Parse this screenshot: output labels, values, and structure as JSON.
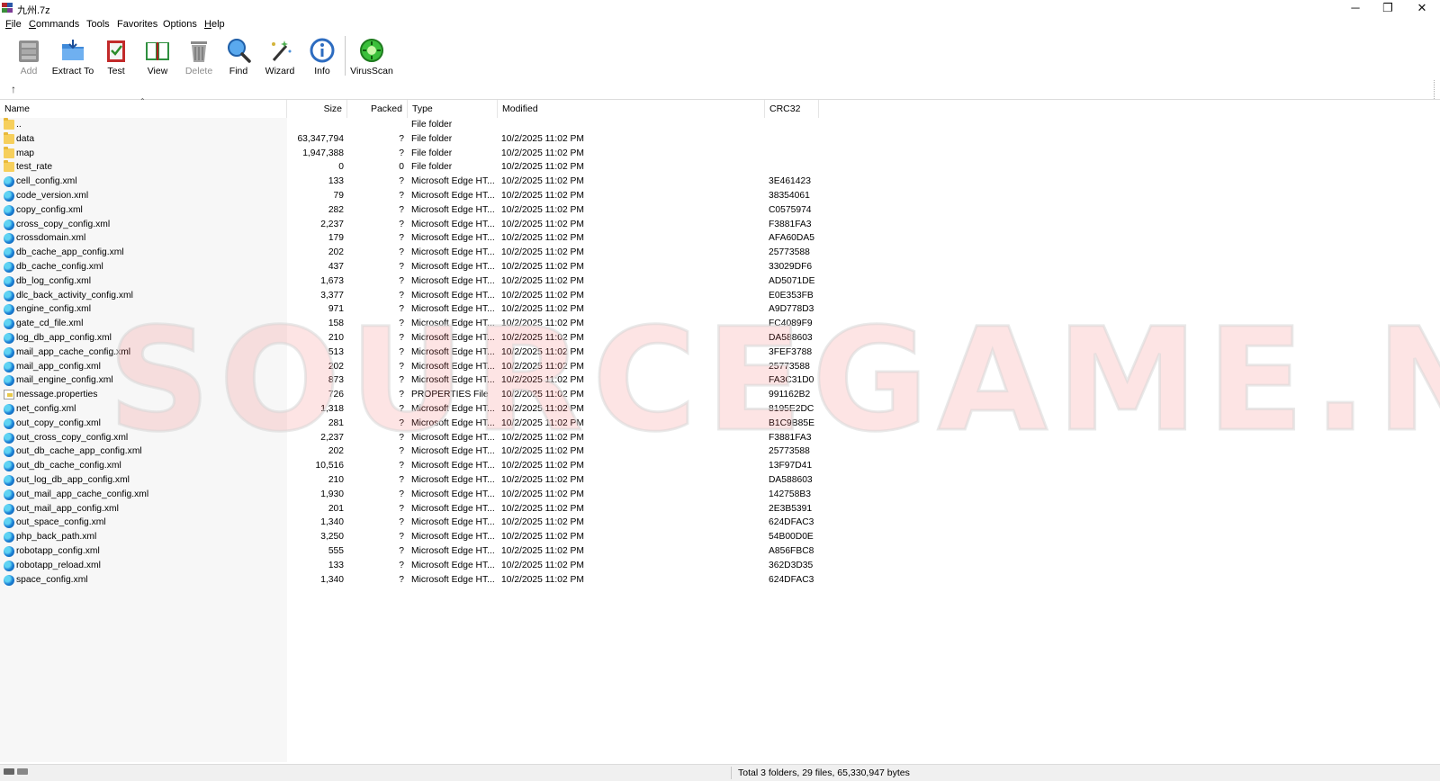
{
  "window": {
    "title": "九州.7z",
    "controls": [
      "─",
      "❐",
      "✕"
    ]
  },
  "menu": [
    {
      "label": "File",
      "key": "F",
      "rest": "ile"
    },
    {
      "label": "Commands",
      "key": "C",
      "rest": "ommands"
    },
    {
      "label": "Tools",
      "key": "",
      "rest": "Tools"
    },
    {
      "label": "Favorites",
      "key": "",
      "rest": "Favorites"
    },
    {
      "label": "Options",
      "key": "",
      "rest": "Options"
    },
    {
      "label": "Help",
      "key": "H",
      "rest": "elp"
    }
  ],
  "toolbar": {
    "add": "Add",
    "extract": "Extract To",
    "test": "Test",
    "view": "View",
    "delete": "Delete",
    "find": "Find",
    "wizard": "Wizard",
    "info": "Info",
    "virusscan": "VirusScan"
  },
  "columns": {
    "name": "Name",
    "size": "Size",
    "packed": "Packed",
    "type": "Type",
    "modified": "Modified",
    "crc": "CRC32"
  },
  "files": [
    {
      "name": "..",
      "size": "",
      "packed": "",
      "type": "File folder",
      "modified": "",
      "crc": "",
      "icon": "folder-icon"
    },
    {
      "name": "data",
      "size": "63,347,794",
      "packed": "?",
      "type": "File folder",
      "modified": "10/2/2025 11:02 PM",
      "crc": "",
      "icon": "folder-icon"
    },
    {
      "name": "map",
      "size": "1,947,388",
      "packed": "?",
      "type": "File folder",
      "modified": "10/2/2025 11:02 PM",
      "crc": "",
      "icon": "folder-icon"
    },
    {
      "name": "test_rate",
      "size": "0",
      "packed": "0",
      "type": "File folder",
      "modified": "10/2/2025 11:02 PM",
      "crc": "",
      "icon": "folder-icon"
    },
    {
      "name": "cell_config.xml",
      "size": "133",
      "packed": "?",
      "type": "Microsoft Edge HT...",
      "modified": "10/2/2025 11:02 PM",
      "crc": "3E461423",
      "icon": "edge-icon"
    },
    {
      "name": "code_version.xml",
      "size": "79",
      "packed": "?",
      "type": "Microsoft Edge HT...",
      "modified": "10/2/2025 11:02 PM",
      "crc": "38354061",
      "icon": "edge-icon"
    },
    {
      "name": "copy_config.xml",
      "size": "282",
      "packed": "?",
      "type": "Microsoft Edge HT...",
      "modified": "10/2/2025 11:02 PM",
      "crc": "C0575974",
      "icon": "edge-icon"
    },
    {
      "name": "cross_copy_config.xml",
      "size": "2,237",
      "packed": "?",
      "type": "Microsoft Edge HT...",
      "modified": "10/2/2025 11:02 PM",
      "crc": "F3881FA3",
      "icon": "edge-icon"
    },
    {
      "name": "crossdomain.xml",
      "size": "179",
      "packed": "?",
      "type": "Microsoft Edge HT...",
      "modified": "10/2/2025 11:02 PM",
      "crc": "AFA60DA5",
      "icon": "edge-icon"
    },
    {
      "name": "db_cache_app_config.xml",
      "size": "202",
      "packed": "?",
      "type": "Microsoft Edge HT...",
      "modified": "10/2/2025 11:02 PM",
      "crc": "25773588",
      "icon": "edge-icon"
    },
    {
      "name": "db_cache_config.xml",
      "size": "437",
      "packed": "?",
      "type": "Microsoft Edge HT...",
      "modified": "10/2/2025 11:02 PM",
      "crc": "33029DF6",
      "icon": "edge-icon"
    },
    {
      "name": "db_log_config.xml",
      "size": "1,673",
      "packed": "?",
      "type": "Microsoft Edge HT...",
      "modified": "10/2/2025 11:02 PM",
      "crc": "AD5071DE",
      "icon": "edge-icon"
    },
    {
      "name": "dlc_back_activity_config.xml",
      "size": "3,377",
      "packed": "?",
      "type": "Microsoft Edge HT...",
      "modified": "10/2/2025 11:02 PM",
      "crc": "E0E353FB",
      "icon": "edge-icon"
    },
    {
      "name": "engine_config.xml",
      "size": "971",
      "packed": "?",
      "type": "Microsoft Edge HT...",
      "modified": "10/2/2025 11:02 PM",
      "crc": "A9D778D3",
      "icon": "edge-icon"
    },
    {
      "name": "gate_cd_file.xml",
      "size": "158",
      "packed": "?",
      "type": "Microsoft Edge HT...",
      "modified": "10/2/2025 11:02 PM",
      "crc": "FC4089F9",
      "icon": "edge-icon"
    },
    {
      "name": "log_db_app_config.xml",
      "size": "210",
      "packed": "?",
      "type": "Microsoft Edge HT...",
      "modified": "10/2/2025 11:02 PM",
      "crc": "DA588603",
      "icon": "edge-icon"
    },
    {
      "name": "mail_app_cache_config.xml",
      "size": "513",
      "packed": "?",
      "type": "Microsoft Edge HT...",
      "modified": "10/2/2025 11:02 PM",
      "crc": "3FEF3788",
      "icon": "edge-icon"
    },
    {
      "name": "mail_app_config.xml",
      "size": "202",
      "packed": "?",
      "type": "Microsoft Edge HT...",
      "modified": "10/2/2025 11:02 PM",
      "crc": "25773588",
      "icon": "edge-icon"
    },
    {
      "name": "mail_engine_config.xml",
      "size": "873",
      "packed": "?",
      "type": "Microsoft Edge HT...",
      "modified": "10/2/2025 11:02 PM",
      "crc": "FA3C31D0",
      "icon": "edge-icon"
    },
    {
      "name": "message.properties",
      "size": "726",
      "packed": "?",
      "type": "PROPERTIES File",
      "modified": "10/2/2025 11:02 PM",
      "crc": "991162B2",
      "icon": "properties-file-icon"
    },
    {
      "name": "net_config.xml",
      "size": "1,318",
      "packed": "?",
      "type": "Microsoft Edge HT...",
      "modified": "10/2/2025 11:02 PM",
      "crc": "8195E2DC",
      "icon": "edge-icon"
    },
    {
      "name": "out_copy_config.xml",
      "size": "281",
      "packed": "?",
      "type": "Microsoft Edge HT...",
      "modified": "10/2/2025 11:02 PM",
      "crc": "B1C9B85E",
      "icon": "edge-icon"
    },
    {
      "name": "out_cross_copy_config.xml",
      "size": "2,237",
      "packed": "?",
      "type": "Microsoft Edge HT...",
      "modified": "10/2/2025 11:02 PM",
      "crc": "F3881FA3",
      "icon": "edge-icon"
    },
    {
      "name": "out_db_cache_app_config.xml",
      "size": "202",
      "packed": "?",
      "type": "Microsoft Edge HT...",
      "modified": "10/2/2025 11:02 PM",
      "crc": "25773588",
      "icon": "edge-icon"
    },
    {
      "name": "out_db_cache_config.xml",
      "size": "10,516",
      "packed": "?",
      "type": "Microsoft Edge HT...",
      "modified": "10/2/2025 11:02 PM",
      "crc": "13F97D41",
      "icon": "edge-icon"
    },
    {
      "name": "out_log_db_app_config.xml",
      "size": "210",
      "packed": "?",
      "type": "Microsoft Edge HT...",
      "modified": "10/2/2025 11:02 PM",
      "crc": "DA588603",
      "icon": "edge-icon"
    },
    {
      "name": "out_mail_app_cache_config.xml",
      "size": "1,930",
      "packed": "?",
      "type": "Microsoft Edge HT...",
      "modified": "10/2/2025 11:02 PM",
      "crc": "142758B3",
      "icon": "edge-icon"
    },
    {
      "name": "out_mail_app_config.xml",
      "size": "201",
      "packed": "?",
      "type": "Microsoft Edge HT...",
      "modified": "10/2/2025 11:02 PM",
      "crc": "2E3B5391",
      "icon": "edge-icon"
    },
    {
      "name": "out_space_config.xml",
      "size": "1,340",
      "packed": "?",
      "type": "Microsoft Edge HT...",
      "modified": "10/2/2025 11:02 PM",
      "crc": "624DFAC3",
      "icon": "edge-icon"
    },
    {
      "name": "php_back_path.xml",
      "size": "3,250",
      "packed": "?",
      "type": "Microsoft Edge HT...",
      "modified": "10/2/2025 11:02 PM",
      "crc": "54B00D0E",
      "icon": "edge-icon"
    },
    {
      "name": "robotapp_config.xml",
      "size": "555",
      "packed": "?",
      "type": "Microsoft Edge HT...",
      "modified": "10/2/2025 11:02 PM",
      "crc": "A856FBC8",
      "icon": "edge-icon"
    },
    {
      "name": "robotapp_reload.xml",
      "size": "133",
      "packed": "?",
      "type": "Microsoft Edge HT...",
      "modified": "10/2/2025 11:02 PM",
      "crc": "362D3D35",
      "icon": "edge-icon"
    },
    {
      "name": "space_config.xml",
      "size": "1,340",
      "packed": "?",
      "type": "Microsoft Edge HT...",
      "modified": "10/2/2025 11:02 PM",
      "crc": "624DFAC3",
      "icon": "edge-icon"
    }
  ],
  "watermark": "SOURCEGAME.NET",
  "status": {
    "summary": "Total 3 folders, 29 files, 65,330,947 bytes"
  }
}
